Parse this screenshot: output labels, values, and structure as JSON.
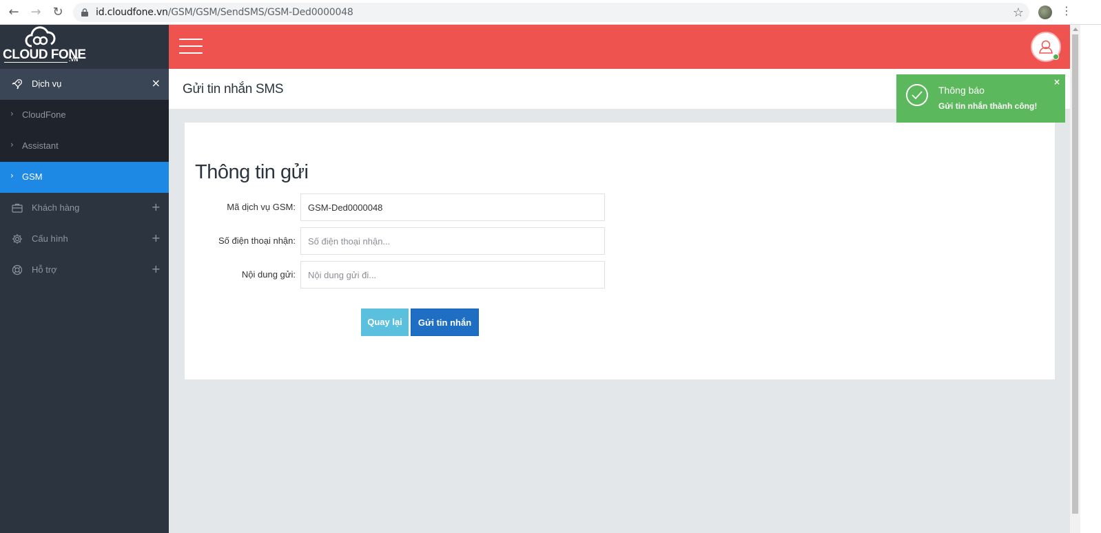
{
  "browser": {
    "url_host": "id.cloudfone.vn",
    "url_path": "/GSM/GSM/SendSMS/GSM-Ded0000048",
    "back_glyph": "←",
    "forward_glyph": "→",
    "reload_glyph": "↻",
    "star_glyph": "☆",
    "menu_glyph": "⋮"
  },
  "logo": {
    "text": "CLOUD FONE",
    "sub": ".VN"
  },
  "sidebar": {
    "section_services": {
      "label": "Dịch vụ",
      "action": "×",
      "icon": "rocket-icon"
    },
    "sub_items": [
      {
        "label": "CloudFone",
        "chevron": "›",
        "active": false
      },
      {
        "label": "Assistant",
        "chevron": "›",
        "active": false
      },
      {
        "label": "GSM",
        "chevron": "›",
        "active": true
      }
    ],
    "sections": [
      {
        "label": "Khách hàng",
        "action": "+",
        "icon": "briefcase-icon"
      },
      {
        "label": "Cấu hình",
        "action": "+",
        "icon": "gear-icon"
      },
      {
        "label": "Hỗ trợ",
        "action": "+",
        "icon": "lifebuoy-icon"
      }
    ]
  },
  "header": {
    "page_title": "Gửi tin nhắn SMS"
  },
  "form": {
    "title": "Thông tin gửi",
    "service_code_label": "Mã dịch vụ GSM:",
    "service_code_value": "GSM-Ded0000048",
    "phone_label": "Số điện thoại nhận:",
    "phone_placeholder": "Số điện thoại nhận...",
    "content_label": "Nội dung gửi:",
    "content_placeholder": "Nội dung gửi đi...",
    "back_button": "Quay lại",
    "send_button": "Gửi tin nhắn"
  },
  "toast": {
    "title": "Thông báo",
    "message": "Gửi tin nhắn thành công!",
    "close": "×"
  },
  "colors": {
    "topbar": "#ef5350",
    "sidebar": "#2c343f",
    "active_item": "#1e88e5",
    "send_button": "#1e6fc4",
    "back_button": "#5bc0de",
    "toast": "#5cb85c"
  }
}
